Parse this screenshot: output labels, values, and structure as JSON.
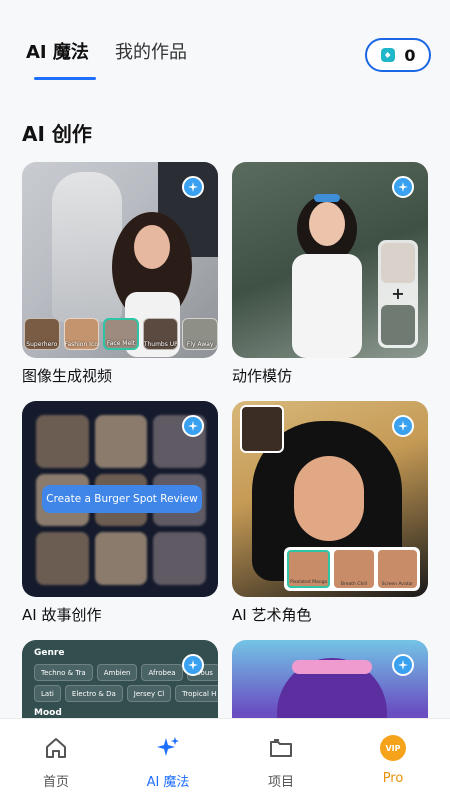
{
  "top_tabs": {
    "active": "AI 魔法",
    "inactive": "我的作品"
  },
  "credits": {
    "count": "0"
  },
  "section": {
    "title": "AI 创作"
  },
  "cards": [
    {
      "caption": "图像生成视频",
      "thumbs": [
        "Superhero",
        "Fashion Icon",
        "Face Melt",
        "Thumbs UP",
        "Fly Away"
      ]
    },
    {
      "caption": "动作模仿"
    },
    {
      "caption": "AI 故事创作",
      "button": "Create a Burger Spot Review"
    },
    {
      "caption": "AI 艺术角色",
      "styles": [
        "Pixelated Mango",
        "Breath Chill",
        "Screen Avatar"
      ]
    },
    {
      "genre_label": "Genre",
      "mood_label": "Mood",
      "chips": [
        "Techno & Tra",
        "Ambien",
        "Afrobea",
        "…ous",
        "Lati",
        "Electro & Da",
        "Jersey Cl",
        "Tropical H"
      ]
    },
    {}
  ],
  "nav": {
    "home": "首页",
    "magic": "AI 魔法",
    "projects": "项目",
    "pro": "Pro",
    "pro_icon": "VIP"
  },
  "colors": {
    "accent": "#1f6fff",
    "pro": "#e8920c",
    "badge": "#3aa0f0"
  }
}
